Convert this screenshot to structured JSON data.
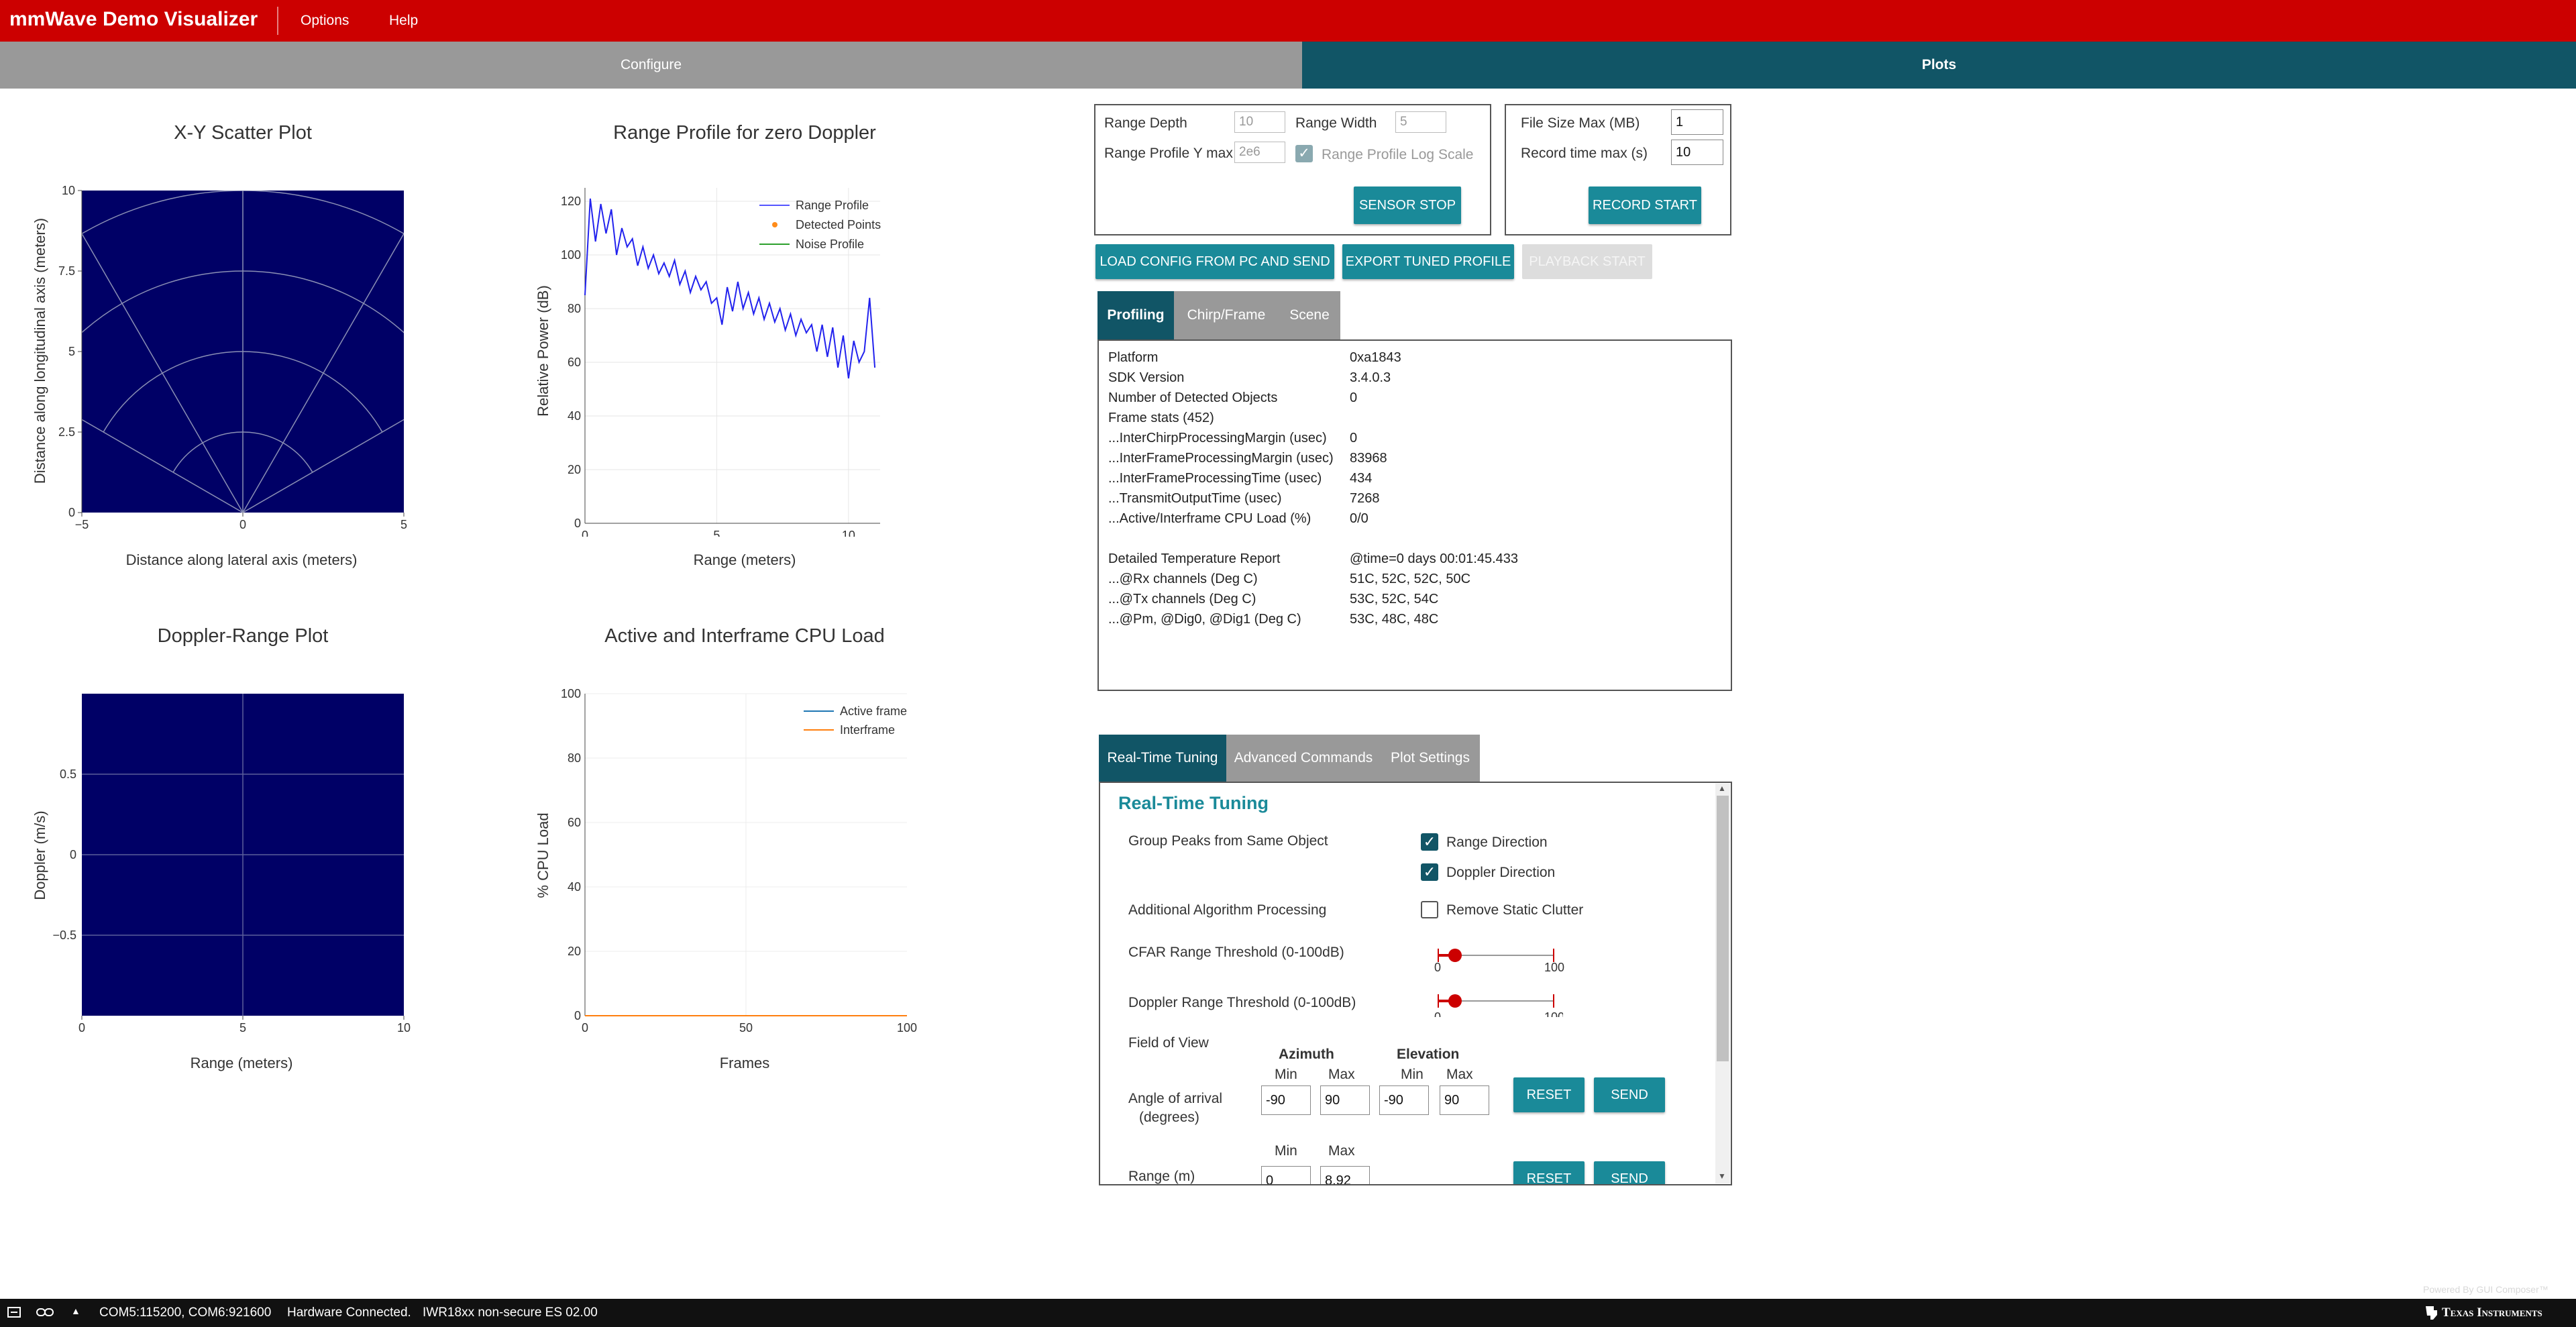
{
  "app": {
    "title": "mmWave Demo Visualizer",
    "menu": [
      "Options",
      "Help"
    ]
  },
  "main_tabs": {
    "configure": "Configure",
    "plots": "Plots"
  },
  "colors": {
    "brand_red": "#cc0000",
    "teal": "#115566",
    "button": "#1a8a99",
    "plot_bg": "#000066"
  },
  "plots": {
    "xy": {
      "title": "X-Y Scatter Plot",
      "xlabel": "Distance along lateral axis (meters)",
      "ylabel": "Distance along longitudinal axis (meters)"
    },
    "range_profile": {
      "title": "Range Profile for zero Doppler",
      "xlabel": "Range (meters)",
      "ylabel": "Relative Power (dB)",
      "legend": [
        "Range Profile",
        "Detected Points",
        "Noise Profile"
      ]
    },
    "doppler": {
      "title": "Doppler-Range Plot",
      "xlabel": "Range (meters)",
      "ylabel": "Doppler (m/s)"
    },
    "cpu": {
      "title": "Active and Interframe  CPU Load",
      "xlabel": "Frames",
      "ylabel": "% CPU Load",
      "legend": [
        "Active frame",
        "Interframe"
      ]
    }
  },
  "chart_data": [
    {
      "type": "scatter",
      "title": "X-Y Scatter Plot",
      "xlabel": "Distance along lateral axis (meters)",
      "ylabel": "Distance along longitudinal axis (meters)",
      "xlim": [
        -5,
        5
      ],
      "ylim": [
        0,
        10
      ],
      "xticks": [
        "−5",
        "0",
        "5"
      ],
      "yticks": [
        "0",
        "2.5",
        "5",
        "7.5",
        "10"
      ],
      "series": [],
      "grid": true
    },
    {
      "type": "line",
      "title": "Range Profile for zero Doppler",
      "xlabel": "Range (meters)",
      "ylabel": "Relative Power (dB)",
      "xlim": [
        0,
        11.2
      ],
      "ylim": [
        0,
        125
      ],
      "xticks": [
        "0",
        "5",
        "10"
      ],
      "yticks": [
        "0",
        "20",
        "40",
        "60",
        "80",
        "100",
        "120"
      ],
      "legend_position": "top-right",
      "series": [
        {
          "name": "Range Profile",
          "x": [
            0,
            0.2,
            0.4,
            0.6,
            0.8,
            1.0,
            1.2,
            1.4,
            1.6,
            1.8,
            2.0,
            2.2,
            2.4,
            2.6,
            2.8,
            3.0,
            3.2,
            3.4,
            3.6,
            3.8,
            4.0,
            4.2,
            4.4,
            4.6,
            4.8,
            5.0,
            5.2,
            5.4,
            5.6,
            5.8,
            6.0,
            6.2,
            6.4,
            6.6,
            6.8,
            7.0,
            7.2,
            7.4,
            7.6,
            7.8,
            8.0,
            8.2,
            8.4,
            8.6,
            8.8,
            9.0,
            9.2,
            9.4,
            9.6,
            9.8,
            10.0,
            10.2,
            10.4,
            10.6,
            10.8,
            11.0
          ],
          "y": [
            85,
            121,
            105,
            119,
            108,
            117,
            100,
            110,
            103,
            106,
            96,
            103,
            95,
            100,
            93,
            97,
            92,
            98,
            89,
            94,
            86,
            92,
            87,
            90,
            82,
            84,
            74,
            88,
            79,
            90,
            80,
            86,
            78,
            84,
            76,
            82,
            75,
            80,
            72,
            78,
            70,
            76,
            71,
            74,
            64,
            74,
            62,
            73,
            58,
            70,
            54,
            68,
            60,
            64,
            84,
            58
          ]
        },
        {
          "name": "Detected Points",
          "x": [],
          "y": []
        },
        {
          "name": "Noise Profile",
          "x": [],
          "y": []
        }
      ]
    },
    {
      "type": "scatter",
      "title": "Doppler-Range Plot",
      "xlabel": "Range (meters)",
      "ylabel": "Doppler (m/s)",
      "xlim": [
        0,
        10
      ],
      "ylim": [
        -1,
        1
      ],
      "xticks": [
        "0",
        "5",
        "10"
      ],
      "yticks": [
        "−0.5",
        "0",
        "0.5"
      ],
      "series": [],
      "grid": true
    },
    {
      "type": "line",
      "title": "Active and Interframe  CPU Load",
      "xlabel": "Frames",
      "ylabel": "% CPU Load",
      "xlim": [
        0,
        100
      ],
      "ylim": [
        0,
        100
      ],
      "xticks": [
        "0",
        "50",
        "100"
      ],
      "yticks": [
        "0",
        "20",
        "40",
        "60",
        "80",
        "100"
      ],
      "legend_position": "top-right",
      "series": [
        {
          "name": "Active frame",
          "x": [
            0,
            100
          ],
          "y": [
            0,
            0
          ]
        },
        {
          "name": "Interframe",
          "x": [
            0,
            100
          ],
          "y": [
            0,
            0
          ]
        }
      ]
    }
  ],
  "top_controls": {
    "range_depth_label": "Range Depth",
    "range_depth_value": "10",
    "range_width_label": "Range Width",
    "range_width_value": "5",
    "range_profile_ymax_label": "Range Profile Y max",
    "range_profile_ymax_value": "2e6",
    "log_scale_label": "Range Profile Log Scale",
    "sensor_stop": "SENSOR STOP",
    "file_size_label": "File Size Max (MB)",
    "file_size_value": "1",
    "record_time_label": "Record time max (s)",
    "record_time_value": "10",
    "record_start": "RECORD START",
    "load_config": "LOAD CONFIG FROM PC AND SEND",
    "export_profile": "EXPORT TUNED PROFILE",
    "playback_start": "PLAYBACK START"
  },
  "profiling": {
    "tabs": [
      "Profiling",
      "Chirp/Frame",
      "Scene"
    ],
    "rows": [
      {
        "label": "Platform",
        "value": "0xa1843"
      },
      {
        "label": "SDK Version",
        "value": "3.4.0.3"
      },
      {
        "label": "Number of Detected Objects",
        "value": "0"
      },
      {
        "label": "Frame stats (452)",
        "value": ""
      },
      {
        "label": "...InterChirpProcessingMargin (usec)",
        "value": "0"
      },
      {
        "label": "...InterFrameProcessingMargin (usec)",
        "value": "83968"
      },
      {
        "label": "...InterFrameProcessingTime (usec)",
        "value": "434"
      },
      {
        "label": "...TransmitOutputTime (usec)",
        "value": "7268"
      },
      {
        "label": "...Active/Interframe CPU Load (%)",
        "value": "0/0"
      },
      {
        "label": "",
        "value": ""
      },
      {
        "label": "Detailed Temperature Report",
        "value": "@time=0 days 00:01:45.433"
      },
      {
        "label": "...@Rx channels (Deg C)",
        "value": "51C, 52C, 52C, 50C"
      },
      {
        "label": "...@Tx channels (Deg C)",
        "value": "53C, 52C, 54C"
      },
      {
        "label": "...@Pm, @Dig0, @Dig1 (Deg C)",
        "value": "53C, 48C, 48C"
      }
    ]
  },
  "tuning": {
    "tabs": [
      "Real-Time Tuning",
      "Advanced Commands",
      "Plot Settings"
    ],
    "heading": "Real-Time Tuning",
    "group_peaks_label": "Group Peaks from Same Object",
    "range_direction": "Range Direction",
    "doppler_direction": "Doppler Direction",
    "additional_label": "Additional Algorithm Processing",
    "remove_clutter": "Remove Static Clutter",
    "cfar_label": "CFAR Range Threshold (0-100dB)",
    "cfar_value": 15,
    "slider_min": "0",
    "slider_max": "100",
    "doppler_thresh_label": "Doppler Range Threshold (0-100dB)",
    "doppler_thresh_value": 15,
    "fov_label": "Field of View",
    "azimuth": "Azimuth",
    "elevation": "Elevation",
    "min": "Min",
    "max": "Max",
    "angle_label_1": "Angle of arrival",
    "angle_label_2": "(degrees)",
    "az_min": "-90",
    "az_max": "90",
    "el_min": "-90",
    "el_max": "90",
    "reset": "RESET",
    "send": "SEND",
    "range_label": "Range (m)",
    "range_min": "0",
    "range_max": "8.92"
  },
  "status": {
    "ports": "COM5:115200, COM6:921600",
    "connection": "Hardware Connected.",
    "device": "IWR18xx non-secure ES 02.00",
    "brand": "Texas Instruments",
    "watermark": "Powered By GUI Composer™"
  }
}
